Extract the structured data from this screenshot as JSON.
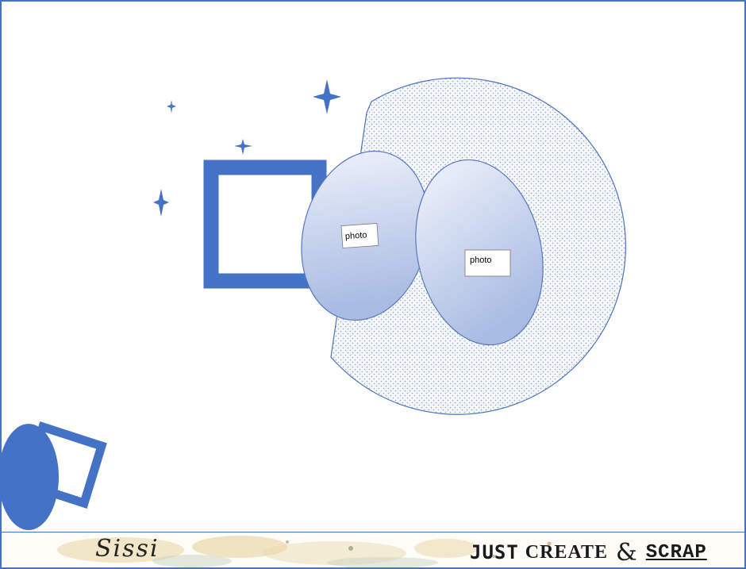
{
  "photo_labels": [
    "photo",
    "photo"
  ],
  "footer": {
    "signature": "Sissi",
    "brand_word1": "JUST",
    "brand_word2": "CREATE",
    "brand_amp": "&",
    "brand_word3": "SCRAP"
  },
  "colors": {
    "accent": "#4472c4",
    "oval_fill_light": "#eef2fa",
    "oval_fill_dark": "#a9bce3",
    "dotted_bg": "#f4f6fb",
    "paint_splash": "#e3c98c"
  }
}
